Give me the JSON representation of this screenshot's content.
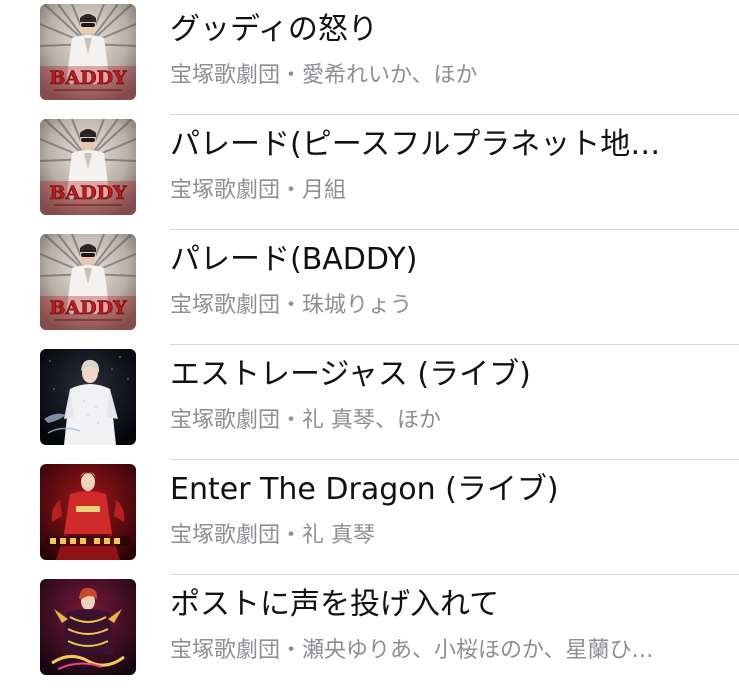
{
  "songs": [
    {
      "title": "グッディの怒り",
      "subtitle": "宝塚歌劇団・愛希れいか、ほか",
      "artwork": "baddy-album-art",
      "artwork_text": "BADDY"
    },
    {
      "title": "パレード(ピースフルプラネット地…",
      "subtitle": "宝塚歌劇団・月組",
      "artwork": "baddy-album-art",
      "artwork_text": "BADDY"
    },
    {
      "title": "パレード(BADDY)",
      "subtitle": "宝塚歌劇団・珠城りょう",
      "artwork": "baddy-album-art",
      "artwork_text": "BADDY"
    },
    {
      "title": "エストレージャス (ライブ)",
      "subtitle": "宝塚歌劇団・礼 真琴、ほか",
      "artwork": "performer-white-costume-art"
    },
    {
      "title": "Enter The Dragon (ライブ)",
      "subtitle": "宝塚歌劇団・礼 真琴",
      "artwork": "performer-red-costume-art"
    },
    {
      "title": "ポストに声を投げ入れて",
      "subtitle": "宝塚歌劇団・瀬央ゆりあ、小桜ほのか、星蘭ひ…",
      "artwork": "performer-gold-costume-art"
    }
  ],
  "colors": {
    "title": "#111111",
    "subtitle": "#8e8e93",
    "separator": "#d8d8dc"
  }
}
